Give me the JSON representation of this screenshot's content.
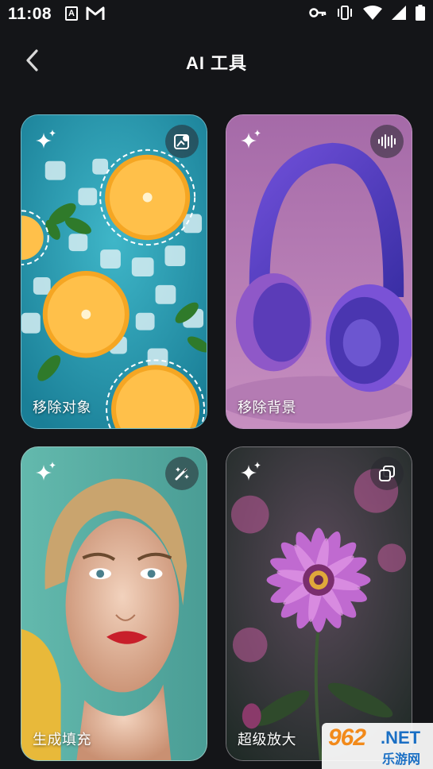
{
  "status_bar": {
    "time": "11:08",
    "left_icons": [
      "a-notification-icon",
      "gmail-icon"
    ],
    "right_icons": [
      "key-icon",
      "vibrate-icon",
      "wifi-icon",
      "signal-icon",
      "battery-icon"
    ]
  },
  "header": {
    "title": "AI 工具",
    "back_icon": "chevron-left-icon"
  },
  "cards": [
    {
      "label": "移除对象",
      "corner_icon": "object-remove-icon"
    },
    {
      "label": "移除背景",
      "corner_icon": "waveform-icon"
    },
    {
      "label": "生成填充",
      "corner_icon": "magic-wand-icon"
    },
    {
      "label": "超级放大",
      "corner_icon": "layers-copy-icon"
    }
  ],
  "watermark": {
    "number": "962",
    "domain": ".NET",
    "subtitle": "乐游网"
  },
  "colors": {
    "background": "#141518",
    "text": "#ffffff",
    "watermark_orange": "#f28a1b",
    "watermark_blue": "#1a6fc4"
  }
}
